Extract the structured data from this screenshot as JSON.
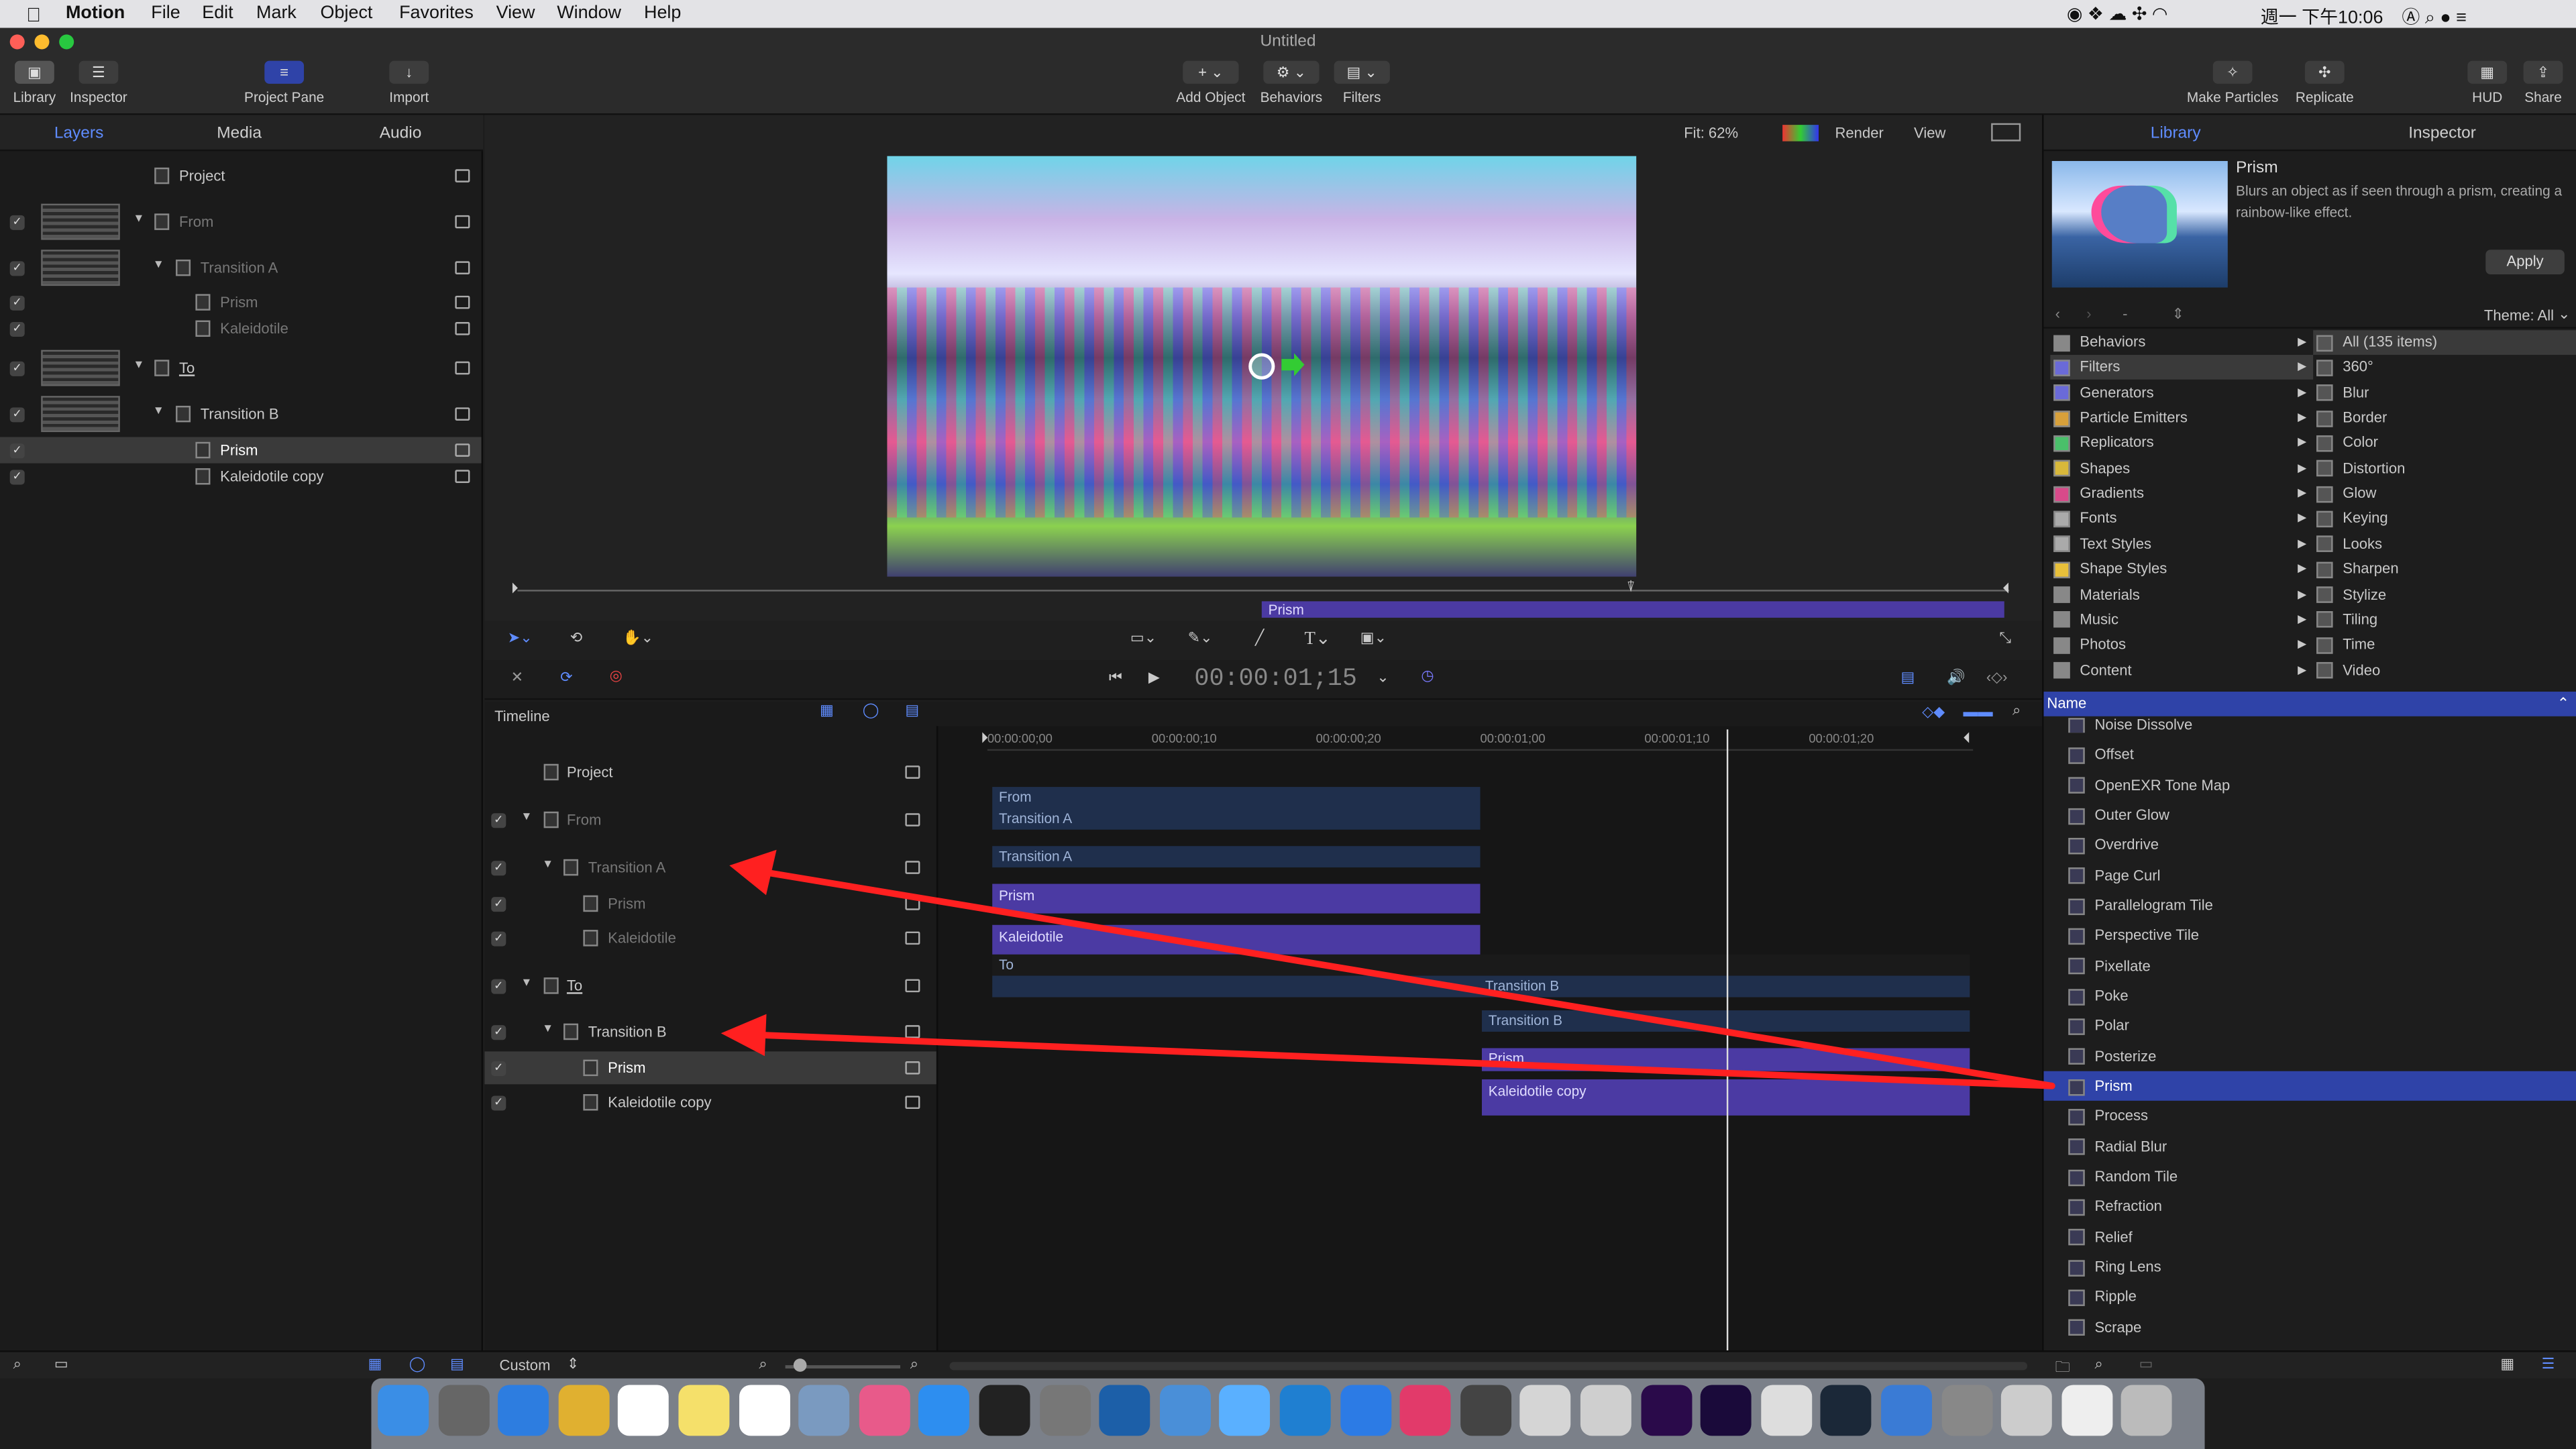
{
  "menubar": {
    "app_name": "Motion",
    "items": [
      "File",
      "Edit",
      "Mark",
      "Object",
      "Favorites",
      "View",
      "Window",
      "Help"
    ],
    "clock": "週一 下午10:06"
  },
  "window": {
    "title": "Untitled"
  },
  "toolbar": {
    "library": "Library",
    "inspector": "Inspector",
    "project_pane": "Project Pane",
    "import": "Import",
    "add_object": "Add Object",
    "behaviors": "Behaviors",
    "filters": "Filters",
    "make_particles": "Make Particles",
    "replicate": "Replicate",
    "hud": "HUD",
    "share": "Share"
  },
  "layers_panel": {
    "tabs": [
      "Layers",
      "Media",
      "Audio"
    ],
    "rows": [
      {
        "name": "Project"
      },
      {
        "name": "From"
      },
      {
        "name": "Transition A"
      },
      {
        "name": "Prism"
      },
      {
        "name": "Kaleidotile"
      },
      {
        "name": "To"
      },
      {
        "name": "Transition B"
      },
      {
        "name": "Prism"
      },
      {
        "name": "Kaleidotile copy"
      }
    ]
  },
  "canvas": {
    "fit": "Fit: 62%",
    "render": "Render",
    "view": "View",
    "prism_bar_label": "Prism"
  },
  "transport": {
    "timecode": "00:00:01;15"
  },
  "timeline": {
    "title": "Timeline",
    "ruler": [
      "00:00:00;00",
      "00:00:00;10",
      "00:00:00;20",
      "00:00:01;00",
      "00:00:01;10",
      "00:00:01;20"
    ],
    "rows": [
      {
        "name": "Project"
      },
      {
        "name": "From"
      },
      {
        "name": "Transition A"
      },
      {
        "name": "Prism"
      },
      {
        "name": "Kaleidotile"
      },
      {
        "name": "To"
      },
      {
        "name": "Transition B"
      },
      {
        "name": "Prism"
      },
      {
        "name": "Kaleidotile copy"
      }
    ],
    "bars": {
      "from": "From",
      "transition_a_1": "Transition A",
      "transition_a_2": "Transition A",
      "prism_a": "Prism",
      "kaleidotile": "Kaleidotile",
      "to": "To",
      "transition_b_1": "Transition B",
      "transition_b_2": "Transition B",
      "prism_b": "Prism",
      "kaleidotile_copy": "Kaleidotile copy"
    },
    "playhead_fraction": 0.75
  },
  "bottom_bar": {
    "custom": "Custom"
  },
  "library_panel": {
    "tabs": [
      "Library",
      "Inspector"
    ],
    "preview_title": "Prism",
    "preview_desc": "Blurs an object as if seen through a prism, creating a rainbow-like effect.",
    "apply": "Apply",
    "theme": "Theme: All",
    "categories": [
      "Behaviors",
      "Filters",
      "Generators",
      "Particle Emitters",
      "Replicators",
      "Shapes",
      "Gradients",
      "Fonts",
      "Text Styles",
      "Shape Styles",
      "Materials",
      "Music",
      "Photos",
      "Content"
    ],
    "subcategories": [
      "All (135 items)",
      "360°",
      "Blur",
      "Border",
      "Color",
      "Distortion",
      "Glow",
      "Keying",
      "Looks",
      "Sharpen",
      "Stylize",
      "Tiling",
      "Time",
      "Video"
    ],
    "list_header": "Name",
    "items": [
      "Noise Dissolve",
      "Offset",
      "OpenEXR Tone Map",
      "Outer Glow",
      "Overdrive",
      "Page Curl",
      "Parallelogram Tile",
      "Perspective Tile",
      "Pixellate",
      "Poke",
      "Polar",
      "Posterize",
      "Prism",
      "Process",
      "Radial Blur",
      "Random Tile",
      "Refraction",
      "Relief",
      "Ring Lens",
      "Ripple",
      "Scrape"
    ],
    "selected_item": "Prism"
  },
  "colors": {
    "accent": "#2f43a8",
    "clip_purple": "#4b3aa3",
    "clip_dark": "#1f2f4c",
    "arrow": "#ff2020"
  }
}
